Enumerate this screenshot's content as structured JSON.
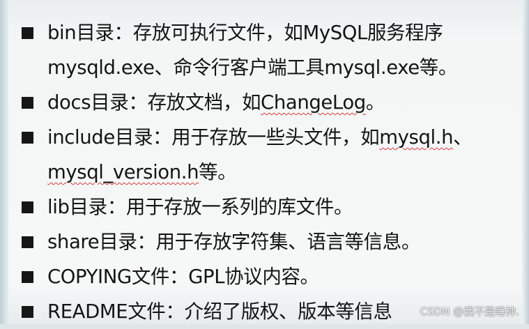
{
  "items": [
    {
      "keyword": "bin",
      "text": "目录：存放可执行文件，如MySQL服务程序",
      "line2": "mysqld.exe、命令行客户端工具mysql.exe等。"
    },
    {
      "keyword": "docs",
      "text": "目录：存放文档，如",
      "link": "ChangeLog",
      "tail": "。"
    },
    {
      "keyword": "include",
      "text": "目录：用于存放一些头文件，如",
      "link": "mysql.h",
      "tail": "、",
      "line2_link": "mysql_version.h",
      "line2_tail": "等。"
    },
    {
      "keyword": "lib",
      "text": "目录：用于存放一系列的库文件。"
    },
    {
      "keyword": "share",
      "text": "目录：用于存放字符集、语言等信息。"
    },
    {
      "keyword": "COPYING",
      "text": "文件：GPL协议内容。"
    },
    {
      "keyword": "README",
      "text": "文件：介绍了版权、版本等信息"
    }
  ],
  "watermark": "CSDN @我不是睡神."
}
